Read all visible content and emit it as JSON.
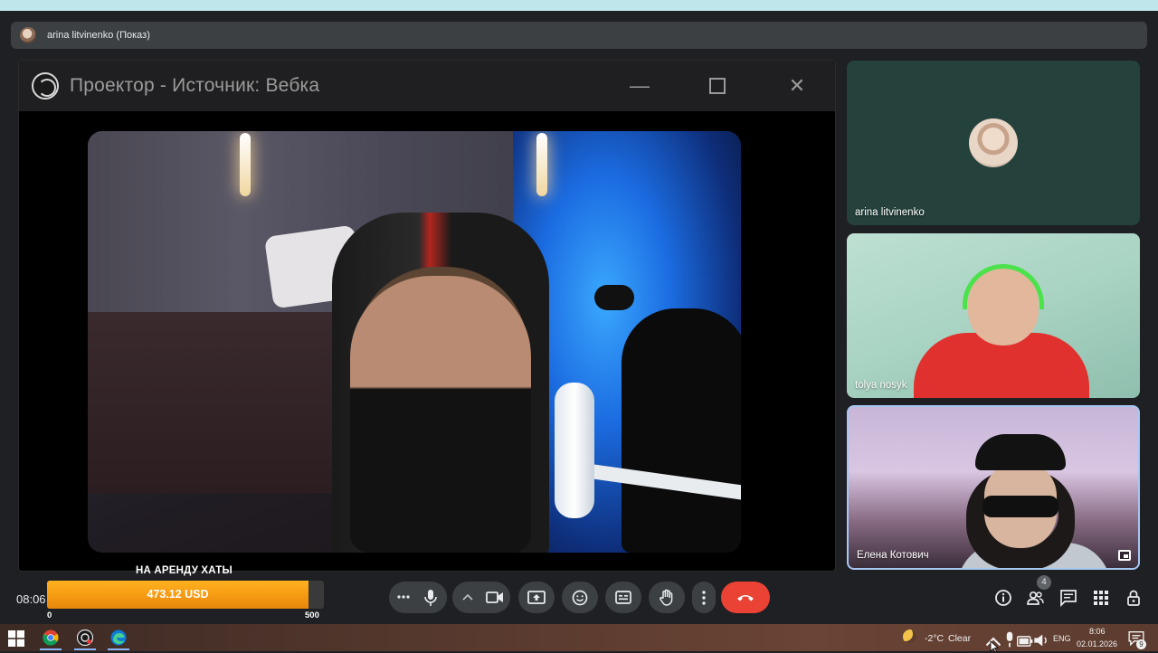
{
  "topbar": {
    "presenter_label": "arina litvinenko (Показ)"
  },
  "projector": {
    "title": "Проектор - Источник: Вебка",
    "minimize_glyph": "—",
    "close_glyph": "✕"
  },
  "participants": [
    {
      "name": "arina litvinenko"
    },
    {
      "name": "tolya nosyk"
    },
    {
      "name": "Елена Котович"
    }
  ],
  "clock": "08:06",
  "donation_goal": {
    "title": "НА АРЕНДУ ХАТЫ",
    "amount": "473.12 USD",
    "min": "0",
    "max": "500",
    "progress": 0.946,
    "fill_color": "#f59a12"
  },
  "controls": {
    "more_options": "more-options",
    "mic": "mic",
    "camera": "camera",
    "present": "present-screen",
    "reactions": "emoji",
    "captions": "captions",
    "raise_hand": "hand",
    "overflow": "more-vert",
    "leave": "call-end",
    "leave_color": "#ea4335"
  },
  "right_controls": {
    "people_count": "4"
  },
  "taskbar": {
    "weather_temp": "-2°C",
    "weather_desc": "Clear",
    "language": "ENG",
    "time": "8:06",
    "date": "02.01.2026",
    "notifications": "9"
  }
}
